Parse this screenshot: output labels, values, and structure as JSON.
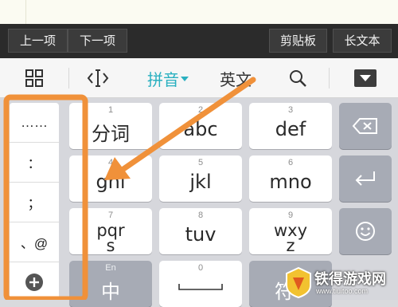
{
  "accessory_bar": {
    "prev_label": "上一项",
    "next_label": "下一项",
    "clipboard_label": "剪贴板",
    "long_text_label": "长文本"
  },
  "toolbar": {
    "pinyin_label": "拼音",
    "english_label": "英文"
  },
  "symbols": [
    "……",
    "：",
    "；",
    "、@"
  ],
  "keys": [
    {
      "num": "1",
      "label": "分词"
    },
    {
      "num": "2",
      "label": "abc"
    },
    {
      "num": "3",
      "label": "def"
    },
    {
      "num": "4",
      "label": "ghi"
    },
    {
      "num": "5",
      "label": "jkl"
    },
    {
      "num": "6",
      "label": "mno"
    },
    {
      "num": "7",
      "label": "pqrs"
    },
    {
      "num": "8",
      "label": "tuv"
    },
    {
      "num": "9",
      "label": "wxyz"
    }
  ],
  "bottom_row": {
    "lang_small": "En",
    "lang_label": "中",
    "zero_num": "0",
    "symbol_label": "符"
  },
  "watermark": {
    "name": "铁得游戏网",
    "url": "www.tiuitoo.com"
  },
  "colors": {
    "accent": "#2ab0c0",
    "highlight": "#f0913a"
  }
}
